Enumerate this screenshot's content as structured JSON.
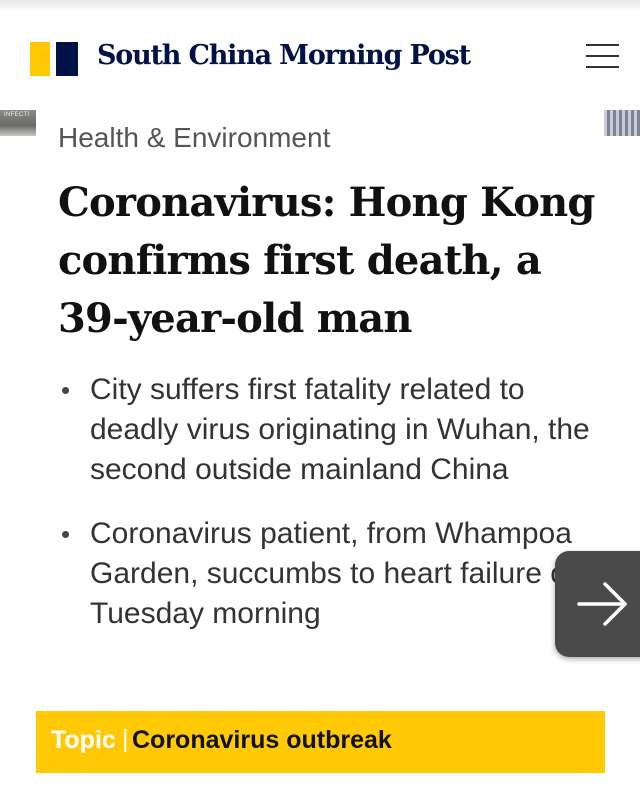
{
  "header": {
    "masthead": "South China Morning Post",
    "menu_icon": "hamburger-menu-icon"
  },
  "carousel": {
    "left_thumb_text": "INFECTI"
  },
  "article": {
    "section": "Health & Environment",
    "headline": "Coronavirus: Hong Kong confirms first death, a 39-year-old man",
    "summary": [
      "City suffers first fatality related to deadly virus originating in Wuhan, the second outside mainland China",
      "Coronavirus patient, from Whampoa Garden, succumbs to heart failure on Tuesday morning"
    ]
  },
  "next_button": {
    "icon": "arrow-right-icon"
  },
  "topic": {
    "label": "Topic",
    "separator": "|",
    "name": "Coronavirus outbreak"
  },
  "colors": {
    "brand_yellow": "#ffca05",
    "brand_navy": "#001246",
    "next_button_bg": "#4a4a4a"
  }
}
